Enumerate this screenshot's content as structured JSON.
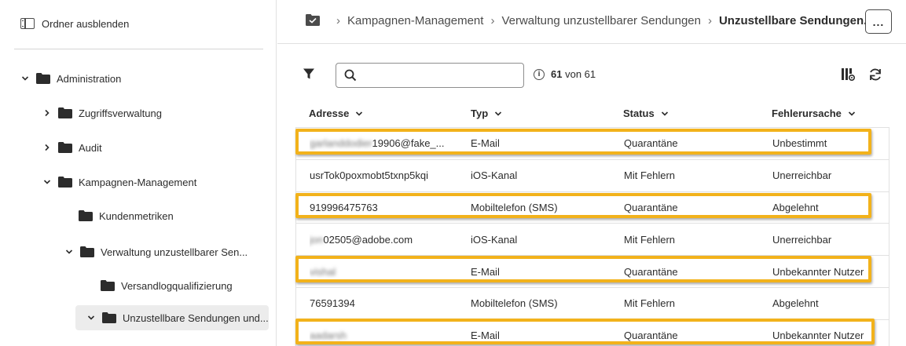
{
  "sidebar": {
    "hide_folders_label": "Ordner ausblenden",
    "tree": [
      {
        "label": "Administration",
        "expanded": true
      },
      {
        "label": "Zugriffsverwaltung",
        "expanded": false
      },
      {
        "label": "Audit",
        "expanded": false
      },
      {
        "label": "Kampagnen-Management",
        "expanded": true
      },
      {
        "label": "Kundenmetriken"
      },
      {
        "label": "Verwaltung unzustellbarer Sen...",
        "expanded": true
      },
      {
        "label": "Versandlogqualifizierung"
      },
      {
        "label": "Unzustellbare Sendungen und...",
        "expanded": true,
        "selected": true
      }
    ]
  },
  "breadcrumb": {
    "items": [
      "Kampagnen-Management",
      "Verwaltung unzustellbarer Sendungen"
    ],
    "current": "Unzustellbare Sendungen...",
    "more_label": "..."
  },
  "toolbar": {
    "search_placeholder": "",
    "search_value": "",
    "count_shown": "61",
    "count_rest": "von 61"
  },
  "table": {
    "columns": [
      "Adresse",
      "Typ",
      "Status",
      "Fehlerursache"
    ],
    "rows": [
      {
        "addr_blurred": "garlanddodier",
        "addr": "19906@fake_...",
        "type": "E-Mail",
        "status": "Quarantäne",
        "cause": "Unbestimmt",
        "highlight": true
      },
      {
        "addr_blurred": "",
        "addr": "usrTok0poxmobt5txnp5kqi",
        "type": "iOS-Kanal",
        "status": "Mit Fehlern",
        "cause": "Unerreichbar",
        "highlight": false
      },
      {
        "addr_blurred": "",
        "addr": "919996475763",
        "type": "Mobiltelefon (SMS)",
        "status": "Quarantäne",
        "cause": "Abgelehnt",
        "highlight": true
      },
      {
        "addr_blurred": "jon",
        "addr": "02505@adobe.com",
        "type": "iOS-Kanal",
        "status": "Mit Fehlern",
        "cause": "Unerreichbar",
        "highlight": false
      },
      {
        "addr_blurred": "vishal",
        "addr": "",
        "type": "E-Mail",
        "status": "Quarantäne",
        "cause": "Unbekannter Nutzer",
        "highlight": true
      },
      {
        "addr_blurred": "",
        "addr": "76591394",
        "type": "Mobiltelefon (SMS)",
        "status": "Mit Fehlern",
        "cause": "Abgelehnt",
        "highlight": false
      },
      {
        "addr_blurred": "aadarsh",
        "addr": "",
        "type": "E-Mail",
        "status": "Quarantäne",
        "cause": "Unbekannter Nutzer",
        "highlight": true
      }
    ]
  },
  "colors": {
    "highlight": "#f2b21b",
    "selected_bg": "#ececec"
  }
}
